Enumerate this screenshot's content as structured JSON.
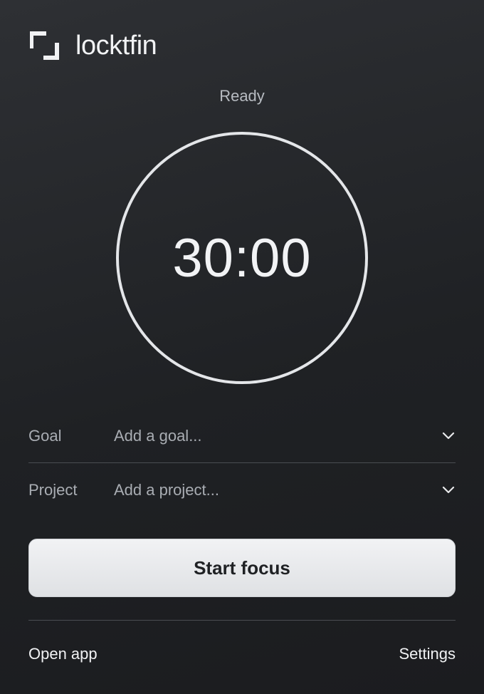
{
  "app": {
    "name": "locktfin",
    "logo_icon": "bracket-frame-icon"
  },
  "status": "Ready",
  "timer": {
    "display": "30:00"
  },
  "fields": {
    "goal": {
      "label": "Goal",
      "placeholder": "Add a goal...",
      "icon": "chevron-down-icon"
    },
    "project": {
      "label": "Project",
      "placeholder": "Add a project...",
      "icon": "chevron-down-icon"
    }
  },
  "actions": {
    "start_label": "Start focus"
  },
  "footer": {
    "open_app_label": "Open app",
    "settings_label": "Settings"
  },
  "colors": {
    "background": "#1f2124",
    "ring": "#e4e6e9",
    "button_bg": "#e8e9eb",
    "muted_text": "#a9adb3"
  }
}
